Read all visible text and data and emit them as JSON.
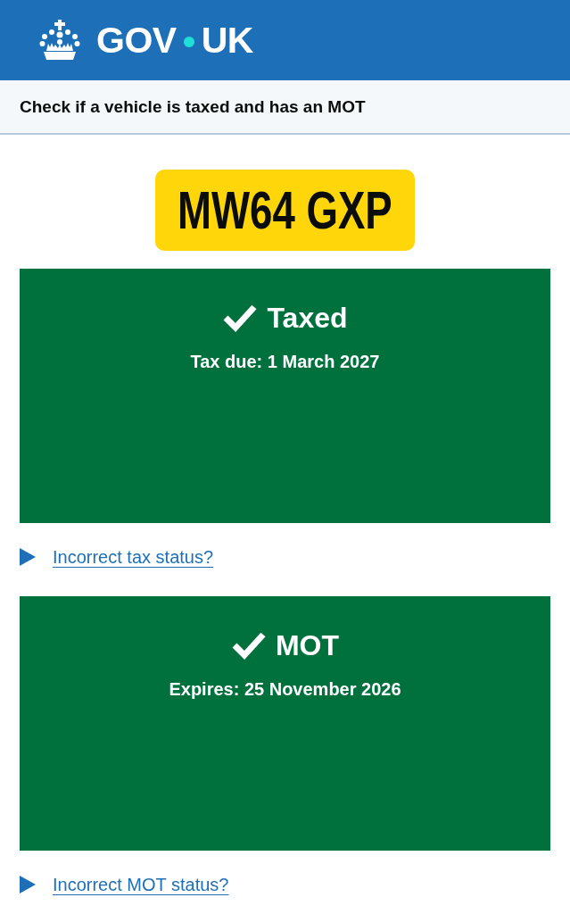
{
  "header": {
    "logo": {
      "left": "GOV",
      "right": "UK"
    }
  },
  "service_name": "Check if a vehicle is taxed and has an MOT",
  "registration": "MW64 GXP",
  "statuses": [
    {
      "kind": "pass",
      "title": "Taxed",
      "detail": "Tax due: 1 March 2027",
      "help_link": {
        "label": "Incorrect tax status?",
        "expanded": false
      }
    },
    {
      "kind": "pass",
      "title": "MOT",
      "detail": "Expires: 25 November 2026",
      "help_link": {
        "label": "Incorrect MOT status?",
        "expanded": false
      }
    }
  ]
}
